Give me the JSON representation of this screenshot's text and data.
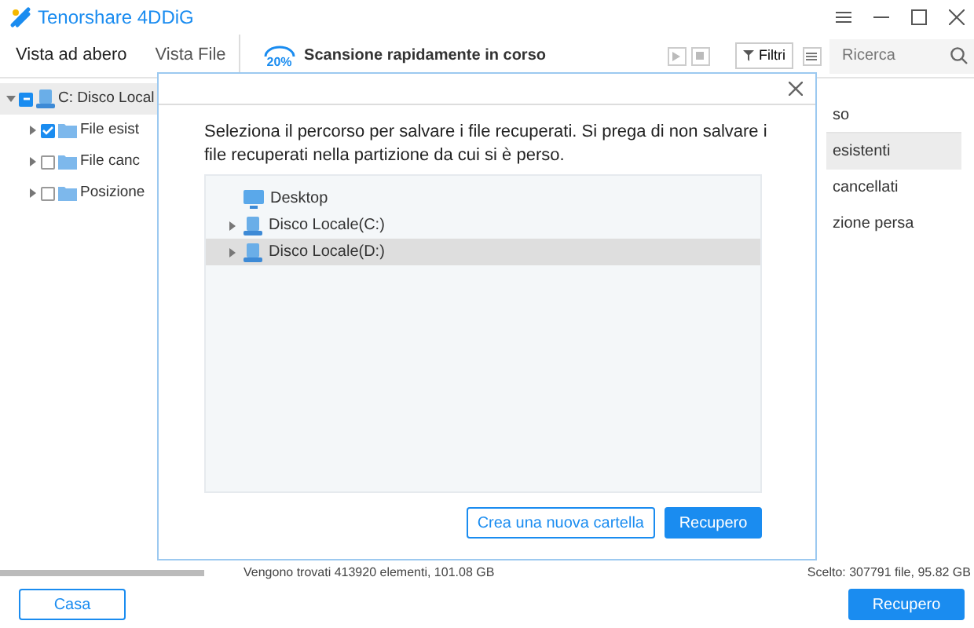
{
  "window": {
    "title": "Tenorshare 4DDiG"
  },
  "view_tabs": [
    {
      "label": "Vista ad abero",
      "selected": true
    },
    {
      "label": "Vista File",
      "selected": false
    }
  ],
  "scan": {
    "percent": "20%",
    "title": "Scansione rapidamente in corso"
  },
  "filter_button": "Filtri",
  "search": {
    "placeholder": "Ricerca"
  },
  "tree": [
    {
      "label": "C: Disco Local",
      "checked": true,
      "partial": true,
      "expanded": true,
      "selected": true,
      "children": [
        {
          "label": "File esist",
          "checked": true,
          "partial": false,
          "expanded": false,
          "selected": false
        },
        {
          "label": "File canc",
          "checked": false,
          "partial": false,
          "expanded": false,
          "selected": false
        },
        {
          "label": "Posizione",
          "checked": false,
          "partial": false,
          "expanded": false,
          "selected": false
        }
      ]
    }
  ],
  "categories": [
    {
      "label": "so",
      "selected": false,
      "kind": "header"
    },
    {
      "label": "esistenti",
      "selected": true,
      "kind": "item"
    },
    {
      "label": "cancellati",
      "selected": false,
      "kind": "item"
    },
    {
      "label": "zione persa",
      "selected": false,
      "kind": "item"
    }
  ],
  "status_bar": {
    "found": "Vengono trovati 413920 elementi, 101.08 GB",
    "chosen": "Scelto: 307791 file, 95.82 GB"
  },
  "bottom_buttons": [
    {
      "label": "Casa",
      "kind": "outline"
    },
    {
      "label": "Recupero",
      "kind": "primary"
    }
  ],
  "dialog": {
    "message": "Seleziona il percorso per salvare i file recuperati. Si prega di non salvare i file recuperati nella partizione da cui si è perso.",
    "locations": [
      {
        "label": "Desktop",
        "kind": "desktop",
        "expandable": false,
        "selected": false
      },
      {
        "label": "Disco Locale(C:)",
        "kind": "drive",
        "expandable": true,
        "selected": false
      },
      {
        "label": "Disco Locale(D:)",
        "kind": "drive",
        "expandable": true,
        "selected": true
      }
    ],
    "buttons": [
      {
        "label": "Crea una nuova cartella",
        "kind": "outline"
      },
      {
        "label": "Recupero",
        "kind": "primary"
      }
    ]
  }
}
